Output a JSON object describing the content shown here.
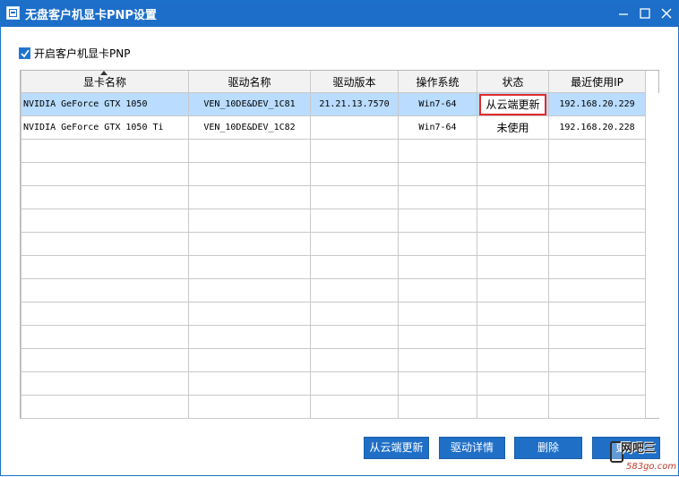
{
  "window": {
    "title": "无盘客户机显卡PNP设置"
  },
  "options": {
    "enable_pnp_label": "开启客户机显卡PNP",
    "enable_pnp_checked": true
  },
  "table": {
    "columns": [
      "显卡名称",
      "驱动名称",
      "驱动版本",
      "操作系统",
      "状态",
      "最近使用IP"
    ],
    "rows": [
      {
        "gpu_name": "NVIDIA GeForce GTX 1050",
        "driver_name": "VEN_10DE&DEV_1C81",
        "driver_version": "21.21.13.7570",
        "os": "Win7-64",
        "status": "从云端更新",
        "last_ip": "192.168.20.229"
      },
      {
        "gpu_name": "NVIDIA GeForce GTX 1050 Ti",
        "driver_name": "VEN_10DE&DEV_1C82",
        "driver_version": "",
        "os": "Win7-64",
        "status": "未使用",
        "last_ip": "192.168.20.228"
      }
    ]
  },
  "buttons": {
    "update_from_cloud": "从云端更新",
    "driver_details": "驱动详情",
    "delete": "删除",
    "update": "更新"
  },
  "watermark": {
    "site_name": "网吧三",
    "url": "583go.com"
  },
  "colors": {
    "titlebar": "#1c6ec9",
    "selected_row": "#b9dcff",
    "highlight_box": "#e02a2a",
    "button": "#1f6fc7"
  }
}
